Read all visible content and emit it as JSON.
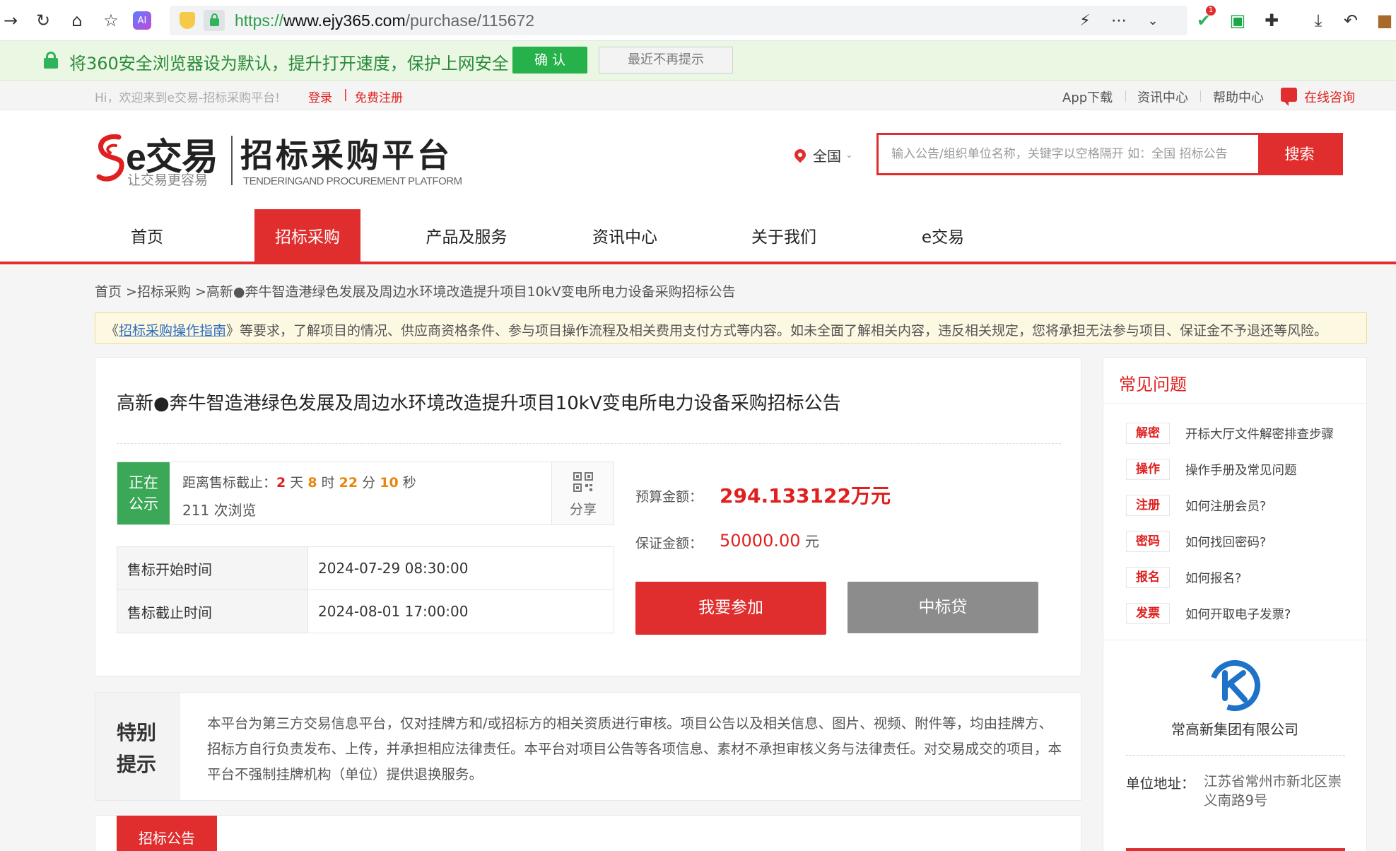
{
  "browser": {
    "url_scheme": "https://",
    "url_domain": "www.ejy365.com",
    "url_path": "/purchase/115672",
    "back_icon": "arrow-right-icon",
    "reload_icon": "reload-icon",
    "ext_badge": "1"
  },
  "notice360": {
    "message": "将360安全浏览器设为默认，提升打开速度，保护上网安全",
    "confirm": "确 认",
    "dismiss": "最近不再提示"
  },
  "topbar": {
    "welcome": "Hi，欢迎来到e交易-招标采购平台!",
    "login": "登录",
    "separator": "|",
    "register": "免费注册",
    "links": [
      "App下载",
      "资讯中心",
      "帮助中心"
    ],
    "consult": "在线咨询"
  },
  "header": {
    "logo_name": "e交易",
    "logo_slogan": "让交易更容易",
    "platform_title": "招标采购平台",
    "platform_en": "TENDERINGAND PROCUREMENT PLATFORM",
    "region": "全国",
    "search_placeholder": "输入公告/组织单位名称，关键字以空格隔开 如：全国 招标公告",
    "search_button": "搜索"
  },
  "nav": {
    "items": [
      "首页",
      "招标采购",
      "产品及服务",
      "资讯中心",
      "关于我们",
      "e交易"
    ],
    "active_index": 1
  },
  "breadcrumb": "首页 >招标采购 >高新●奔牛智造港绿色发展及周边水环境改造提升项目10kV变电所电力设备采购招标公告",
  "guide": {
    "prefix": "《",
    "link": "招标采购操作指南",
    "suffix": "》等要求，了解项目的情况、供应商资格条件、参与项目操作流程及相关费用支付方式等内容。如未全面了解相关内容，违反相关规定，您将承担无法参与项目、保证金不予退还等风险。"
  },
  "project": {
    "title": "高新●奔牛智造港绿色发展及周边水环境改造提升项目10kV变电所电力设备采购招标公告",
    "status": "正在公示",
    "countdown_label": "距离售标截止：",
    "days": "2",
    "days_unit": " 天 ",
    "hours": "8",
    "hours_unit": " 时 ",
    "minutes": "22",
    "minutes_unit": " 分 ",
    "seconds": "10",
    "seconds_unit": " 秒",
    "views": "211 次浏览",
    "share": "分享",
    "times": [
      {
        "label": "售标开始时间",
        "value": "2024-07-29 08:30:00"
      },
      {
        "label": "售标截止时间",
        "value": "2024-08-01 17:00:00"
      }
    ],
    "budget_label": "预算金额：",
    "budget": "294.133122万元",
    "deposit_label": "保证金额：",
    "deposit": "50000.00",
    "deposit_unit": " 元",
    "join_button": "我要参加",
    "loan_button": "中标贷"
  },
  "special_notice": {
    "label": "特别提示",
    "body": "本平台为第三方交易信息平台，仅对挂牌方和/或招标方的相关资质进行审核。项目公告以及相关信息、图片、视频、附件等，均由挂牌方、招标方自行负责发布、上传，并承担相应法律责任。本平台对项目公告等各项信息、素材不承担审核义务与法律责任。对交易成交的项目，本平台不强制挂牌机构（单位）提供退换服务。"
  },
  "tabs": [
    "招标公告"
  ],
  "sidebar": {
    "faq_title": "常见问题",
    "faqs": [
      {
        "tag": "解密",
        "q": "开标大厅文件解密排查步骤"
      },
      {
        "tag": "操作",
        "q": "操作手册及常见问题"
      },
      {
        "tag": "注册",
        "q": "如何注册会员?"
      },
      {
        "tag": "密码",
        "q": "如何找回密码?"
      },
      {
        "tag": "报名",
        "q": "如何报名?"
      },
      {
        "tag": "发票",
        "q": "如何开取电子发票?"
      }
    ],
    "company": "常高新集团有限公司",
    "address_label": "单位地址：",
    "address": "江苏省常州市新北区崇义南路9号"
  },
  "colors": {
    "brand_red": "#e02e2e",
    "status_green": "#3aa856",
    "notice_green": "#27b14b",
    "countdown_orange": "#e8860f"
  }
}
